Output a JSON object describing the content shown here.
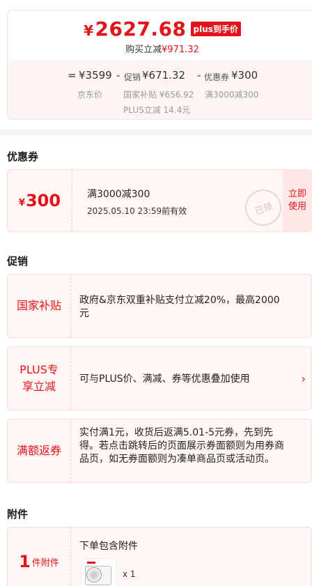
{
  "price": {
    "currency_symbol": "¥",
    "final_price": "2627.68",
    "plus_badge": "plus到手价",
    "buy_reduce_label": "购买立减",
    "buy_reduce_amount": "¥971.32"
  },
  "breakdown": {
    "eq": "=",
    "jd_price": "¥3599",
    "minus1": "-",
    "promo_label": "促销",
    "promo_amount": "¥671.32",
    "minus2": "-",
    "coupon_label": "优惠券",
    "coupon_amount": "¥300",
    "jd_price_label": "京东价",
    "subsidy_label": "国家补贴 ¥656.92",
    "full_reduce_label": "满3000减300",
    "plus_reduce_label": "PLUS立减 14.4元"
  },
  "coupon_section": {
    "title": "优惠券",
    "coupon": {
      "currency": "¥",
      "amount": "300",
      "condition": "满3000减300",
      "validity": "2025.05.10 23:59前有效",
      "stamp": "已领",
      "action_line1": "立即",
      "action_line2": "使用"
    }
  },
  "promo_section": {
    "title": "促销",
    "items": [
      {
        "label": "国家补贴",
        "text": "政府&京东双重补贴支付立减20%，最高2000元"
      },
      {
        "label": "PLUS专享立减",
        "label_line1": "PLUS专",
        "label_line2": "享立减",
        "text": "可与PLUS价、满减、券等优惠叠加使用",
        "chevron": "›"
      },
      {
        "label": "满额返券",
        "text": "实付满1元，收货后返满5.01-5元券，先到先得。若点击跳转后的页面展示券面额则为用券商品页，如无券面额则为凑单商品页或活动页。"
      }
    ]
  },
  "attachment_section": {
    "title": "附件",
    "count": "1",
    "unit": "件附件",
    "heading": "下单包含附件",
    "qty": "x 1"
  },
  "colors": {
    "accent": "#e4131a",
    "card_bg": "#fff6f5"
  }
}
